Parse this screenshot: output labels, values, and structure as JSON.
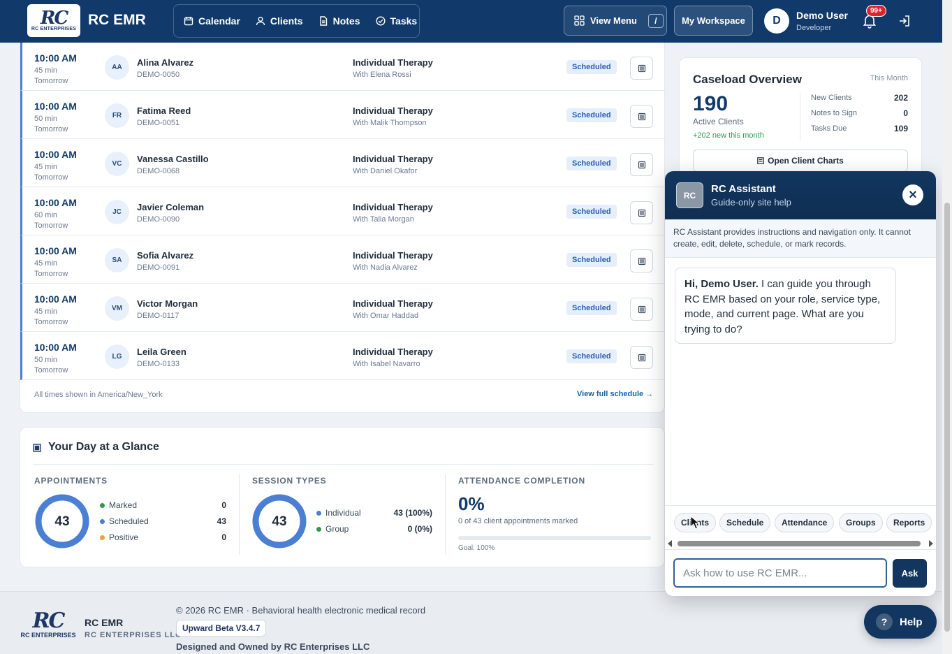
{
  "header": {
    "logo_mark": "RC",
    "logo_sub": "RC ENTERPRISES",
    "brand": "RC EMR",
    "nav": [
      {
        "label": "Calendar",
        "icon": "calendar-icon"
      },
      {
        "label": "Clients",
        "icon": "user-icon"
      },
      {
        "label": "Notes",
        "icon": "document-icon"
      },
      {
        "label": "Tasks",
        "icon": "check-circle-icon"
      }
    ],
    "view_menu": "View Menu",
    "view_menu_key": "/",
    "workspace": "My Workspace",
    "user_initial": "D",
    "user_name": "Demo User",
    "user_role": "Developer",
    "notif_badge": "99+"
  },
  "appointments": [
    {
      "time": "10:00 AM",
      "duration": "45 min",
      "day": "Tomorrow",
      "initials": "AA",
      "name": "Alina Alvarez",
      "id": "DEMO-0050",
      "service": "Individual Therapy",
      "with": "With Elena Rossi",
      "status": "Scheduled"
    },
    {
      "time": "10:00 AM",
      "duration": "50 min",
      "day": "Tomorrow",
      "initials": "FR",
      "name": "Fatima Reed",
      "id": "DEMO-0051",
      "service": "Individual Therapy",
      "with": "With Malik Thompson",
      "status": "Scheduled"
    },
    {
      "time": "10:00 AM",
      "duration": "45 min",
      "day": "Tomorrow",
      "initials": "VC",
      "name": "Vanessa Castillo",
      "id": "DEMO-0068",
      "service": "Individual Therapy",
      "with": "With Daniel Okafor",
      "status": "Scheduled"
    },
    {
      "time": "10:00 AM",
      "duration": "60 min",
      "day": "Tomorrow",
      "initials": "JC",
      "name": "Javier Coleman",
      "id": "DEMO-0090",
      "service": "Individual Therapy",
      "with": "With Talia Morgan",
      "status": "Scheduled"
    },
    {
      "time": "10:00 AM",
      "duration": "45 min",
      "day": "Tomorrow",
      "initials": "SA",
      "name": "Sofia Alvarez",
      "id": "DEMO-0091",
      "service": "Individual Therapy",
      "with": "With Nadia Alvarez",
      "status": "Scheduled"
    },
    {
      "time": "10:00 AM",
      "duration": "45 min",
      "day": "Tomorrow",
      "initials": "VM",
      "name": "Victor Morgan",
      "id": "DEMO-0117",
      "service": "Individual Therapy",
      "with": "With Omar Haddad",
      "status": "Scheduled"
    },
    {
      "time": "10:00 AM",
      "duration": "50 min",
      "day": "Tomorrow",
      "initials": "LG",
      "name": "Leila Green",
      "id": "DEMO-0133",
      "service": "Individual Therapy",
      "with": "With Isabel Navarro",
      "status": "Scheduled"
    }
  ],
  "schedule_footer": {
    "tz_note": "All times shown in America/New_York",
    "view_full": "View full schedule →"
  },
  "glance": {
    "title": "Your Day at a Glance",
    "appointments": {
      "title": "APPOINTMENTS",
      "total": "43",
      "legend": [
        {
          "label": "Marked",
          "value": "0",
          "color": "#2e9a4f"
        },
        {
          "label": "Scheduled",
          "value": "43",
          "color": "#4a7fd4"
        },
        {
          "label": "Positive",
          "value": "0",
          "color": "#f0a030"
        }
      ]
    },
    "session_types": {
      "title": "SESSION TYPES",
      "total": "43",
      "legend": [
        {
          "label": "Individual",
          "value": "43 (100%)",
          "color": "#4a7fd4"
        },
        {
          "label": "Group",
          "value": "0 (0%)",
          "color": "#2e9a4f"
        }
      ]
    },
    "attendance": {
      "title": "ATTENDANCE COMPLETION",
      "percent": "0%",
      "subtitle": "0 of 43 client appointments marked",
      "progress": 0,
      "goal": "Goal: 100%"
    }
  },
  "caseload": {
    "title": "Caseload Overview",
    "period": "This Month",
    "active_count": "190",
    "active_label": "Active Clients",
    "new_this_month": "+202 new this month",
    "stats": [
      {
        "label": "New Clients",
        "value": "202"
      },
      {
        "label": "Notes to Sign",
        "value": "0"
      },
      {
        "label": "Tasks Due",
        "value": "109"
      }
    ],
    "open_charts": "Open Client Charts"
  },
  "assistant": {
    "logo": "RC",
    "title": "RC Assistant",
    "subtitle": "Guide-only site help",
    "info": "RC Assistant provides instructions and navigation only. It cannot create, edit, delete, schedule, or mark records.",
    "greeting_bold": "Hi, Demo User.",
    "greeting_rest": " I can guide you through RC EMR based on your role, service type, mode, and current page. What are you trying to do?",
    "chips": [
      "Clients",
      "Schedule",
      "Attendance",
      "Groups",
      "Reports"
    ],
    "input_placeholder": "Ask how to use RC EMR...",
    "ask": "Ask"
  },
  "footer": {
    "logo_mark": "RC",
    "logo_sub": "RC ENTERPRISES",
    "brand": "RC EMR",
    "llc": "RC ENTERPRISES LLC",
    "copyright": "© 2026 RC EMR · Behavioral health electronic medical record",
    "version": "Upward Beta V3.4.7",
    "designed": "Designed and Owned by RC Enterprises LLC"
  },
  "help": {
    "label": "Help",
    "glyph": "?"
  }
}
